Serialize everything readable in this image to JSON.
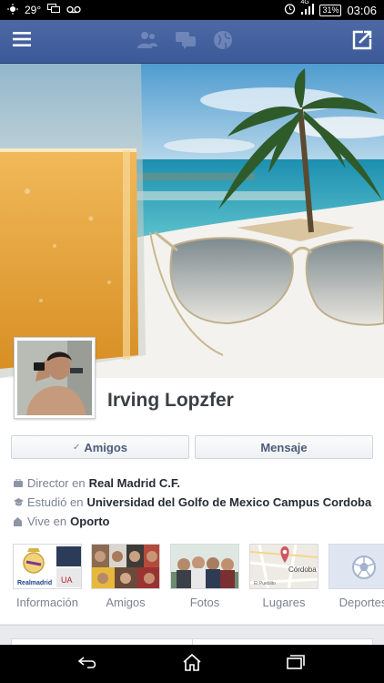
{
  "status_bar": {
    "temperature": "29°",
    "network": "4G",
    "battery": "31%",
    "time": "03:06"
  },
  "profile": {
    "name": "Irving Lopzfer"
  },
  "buttons": {
    "friends": "Amigos",
    "message": "Mensaje"
  },
  "info": [
    {
      "label": "Director en",
      "value": "Real Madrid C.F.",
      "icon": "briefcase-icon"
    },
    {
      "label": "Estudió en",
      "value": "Universidad del Golfo de Mexico Campus Cordoba",
      "icon": "graduation-cap-icon"
    },
    {
      "label": "Vive en",
      "value": "Oporto",
      "icon": "home-icon"
    }
  ],
  "tiles": {
    "info": {
      "label": "Información",
      "logo_text": "Realmadrid"
    },
    "friends": {
      "label": "Amigos"
    },
    "photos": {
      "label": "Fotos"
    },
    "places": {
      "label": "Lugares",
      "map_city": "Córdoba",
      "map_place": "El Pueblito"
    },
    "sports": {
      "label": "Deportes"
    }
  },
  "colors": {
    "header_blue": "#3b5998",
    "name_text": "#3b3f46",
    "link_text": "#262b35",
    "muted_text": "#7b8292"
  }
}
